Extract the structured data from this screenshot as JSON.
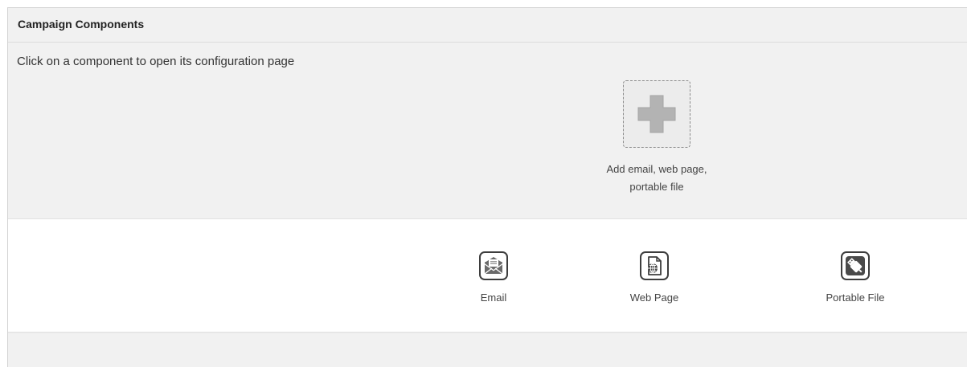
{
  "panel": {
    "title": "Campaign Components",
    "instruction": "Click on a component to open its configuration page"
  },
  "add_component": {
    "label": "Add email, web page,\nportable file",
    "icon": "plus-icon"
  },
  "component_options": [
    {
      "label": "Email",
      "icon": "email-icon"
    },
    {
      "label": "Web Page",
      "icon": "web-page-icon"
    },
    {
      "label": "Portable File",
      "icon": "usb-drive-icon"
    }
  ]
}
